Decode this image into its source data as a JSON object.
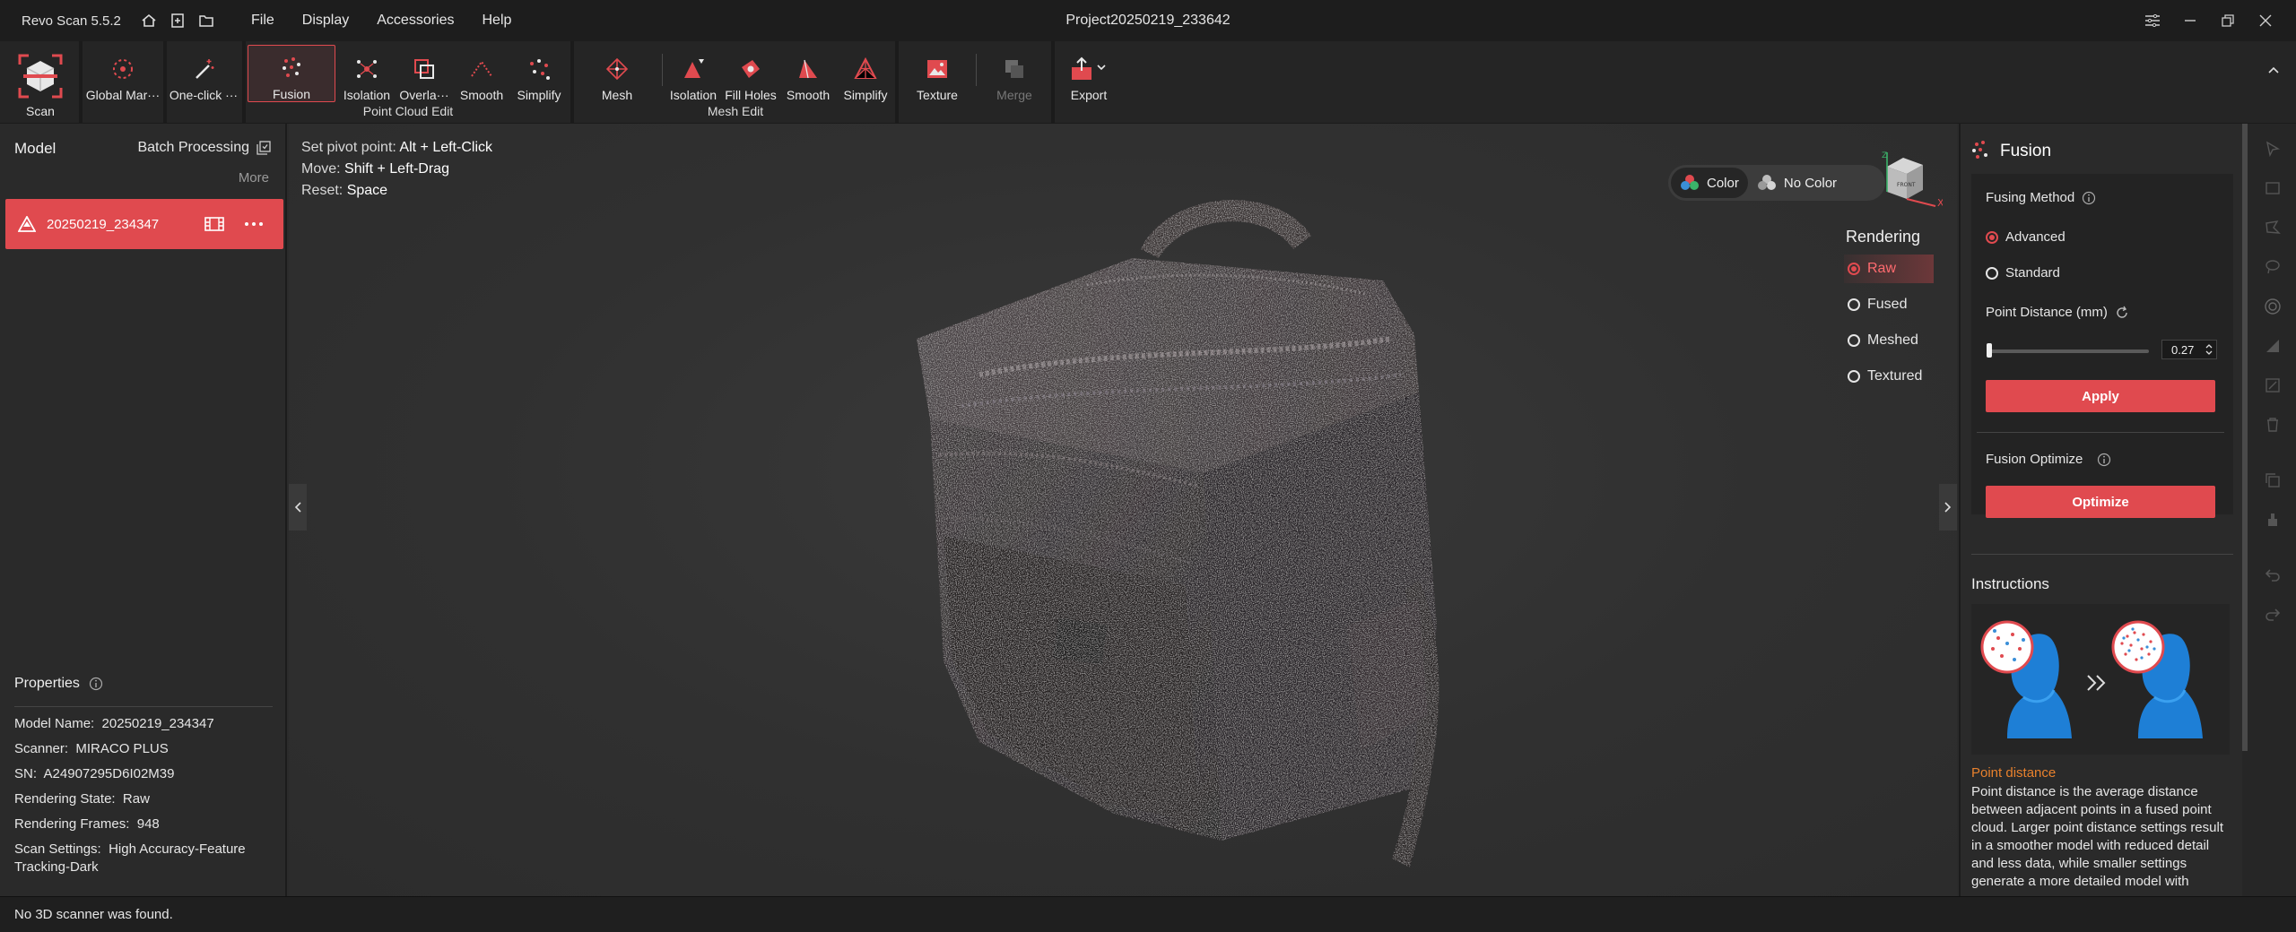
{
  "titlebar": {
    "app_name": "Revo Scan 5.5.2",
    "project_title": "Project20250219_233642",
    "menu": [
      "File",
      "Display",
      "Accessories",
      "Help"
    ]
  },
  "toolbar": {
    "scan": "Scan",
    "global_markers": "Global Mar···",
    "one_click": "One-click ···",
    "fusion": "Fusion",
    "pc_isolation": "Isolation",
    "pc_overlap": "Overla···",
    "pc_smooth": "Smooth",
    "pc_simplify": "Simplify",
    "point_cloud_edit": "Point Cloud Edit",
    "mesh": "Mesh",
    "mesh_isolation": "Isolation",
    "fill_holes": "Fill Holes",
    "mesh_smooth": "Smooth",
    "mesh_simplify": "Simplify",
    "mesh_edit": "Mesh Edit",
    "texture": "Texture",
    "merge": "Merge",
    "export": "Export"
  },
  "left": {
    "model_header": "Model",
    "batch_processing": "Batch Processing",
    "more": "More",
    "model_name": "20250219_234347",
    "properties_title": "Properties",
    "properties": [
      {
        "label": "Model Name:",
        "value": "20250219_234347"
      },
      {
        "label": "Scanner:",
        "value": "MIRACO PLUS"
      },
      {
        "label": "SN:",
        "value": "A24907295D6I02M39"
      },
      {
        "label": "Rendering State:",
        "value": "Raw"
      },
      {
        "label": "Rendering Frames:",
        "value": "948"
      },
      {
        "label": "Scan Settings:",
        "value": "High Accuracy-Feature Tracking-Dark"
      }
    ]
  },
  "viewport": {
    "hints": [
      {
        "label": "Set pivot point:",
        "key": "Alt + Left-Click"
      },
      {
        "label": "Move:",
        "key": "Shift + Left-Drag"
      },
      {
        "label": "Reset:",
        "key": "Space"
      }
    ],
    "color_label": "Color",
    "no_color_label": "No Color",
    "rendering_title": "Rendering",
    "rendering_options": [
      "Raw",
      "Fused",
      "Meshed",
      "Textured"
    ],
    "rendering_selected": "Raw",
    "cube_front": "FRONT",
    "axis_x": "X",
    "axis_z": "Z"
  },
  "right": {
    "title": "Fusion",
    "fusing_method": "Fusing Method",
    "advanced": "Advanced",
    "standard": "Standard",
    "point_distance": "Point Distance (mm)",
    "point_distance_value": "0.27",
    "apply": "Apply",
    "fusion_optimize": "Fusion Optimize",
    "optimize": "Optimize",
    "instructions": "Instructions",
    "pd_title": "Point distance",
    "pd_text": "Point distance is the average distance between adjacent points in a fused point cloud. Larger point distance settings result in a smoother model with reduced detail and less data, while smaller settings generate a more detailed model with"
  },
  "status": {
    "message": "No 3D scanner was found."
  },
  "colors": {
    "accent": "#e04a4f",
    "orange": "#e8812d"
  }
}
